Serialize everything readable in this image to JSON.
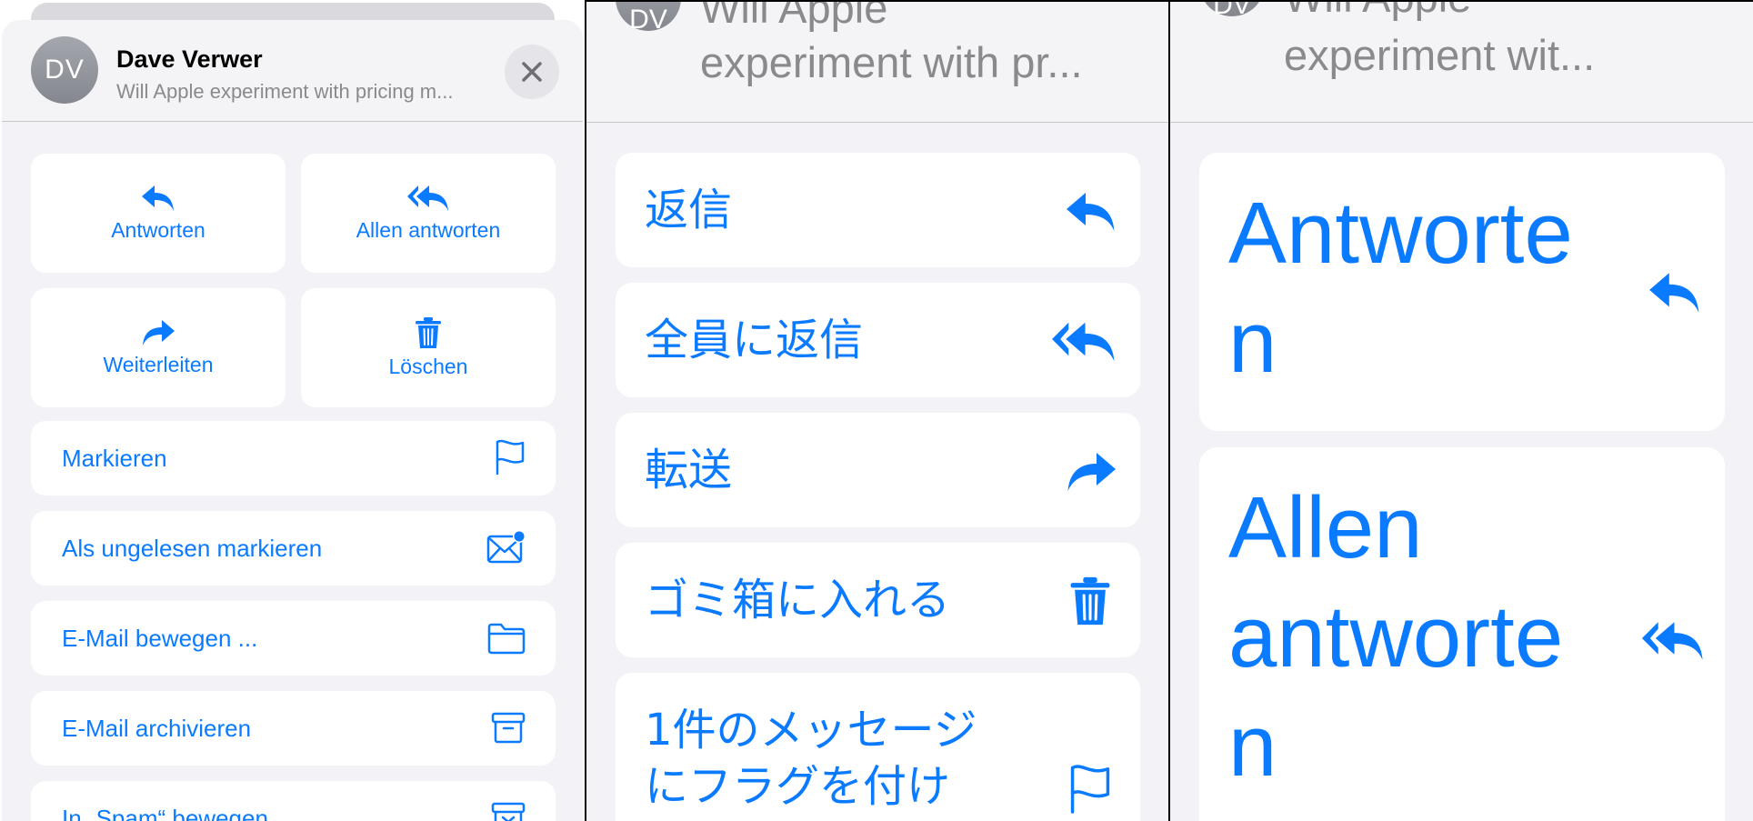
{
  "panel_left": {
    "header": {
      "avatar_initials": "DV",
      "sender": "Dave Verwer",
      "subject": "Will Apple experiment with pricing m..."
    },
    "tiles": [
      {
        "label": "Antworten",
        "icon": "reply-icon"
      },
      {
        "label": "Allen antworten",
        "icon": "reply-all-icon"
      },
      {
        "label": "Weiterleiten",
        "icon": "forward-icon"
      },
      {
        "label": "Löschen",
        "icon": "trash-icon"
      }
    ],
    "rows": [
      {
        "label": "Markieren",
        "icon": "flag-icon"
      },
      {
        "label": "Als ungelesen markieren",
        "icon": "unread-envelope-icon"
      },
      {
        "label": "E-Mail bewegen ...",
        "icon": "folder-icon"
      },
      {
        "label": "E-Mail archivieren",
        "icon": "archive-icon"
      },
      {
        "label": "In „Spam“ bewegen",
        "icon": "junk-icon"
      }
    ]
  },
  "panel_middle": {
    "ghost_avatar": "DV",
    "subject_line1": "Will Apple",
    "subject_line2": "experiment with pr...",
    "rows": [
      {
        "label": "返信",
        "icon": "reply-icon"
      },
      {
        "label": "全員に返信",
        "icon": "reply-all-icon"
      },
      {
        "label": "転送",
        "icon": "forward-icon"
      },
      {
        "label": "ゴミ箱に入れる",
        "icon": "trash-icon"
      },
      {
        "label_line1": "1件のメッセージ",
        "label_line2": "にフラグを付け",
        "icon": "flag-icon"
      }
    ]
  },
  "panel_right": {
    "ghost_avatar": "DV",
    "subject_line1": "Will Apple",
    "subject_line2": "experiment wit...",
    "rows": [
      {
        "label_line1": "Antworte",
        "label_line2": "n",
        "icon": "reply-icon"
      },
      {
        "label_line1": "Allen",
        "label_line2": "antworte",
        "label_line3": "n",
        "icon": "reply-all-icon"
      }
    ]
  },
  "colors": {
    "accent": "#0a7aff",
    "secondary_text": "#8a8a8e",
    "sheet_background": "#f2f2f7",
    "row_background": "#ffffff"
  }
}
